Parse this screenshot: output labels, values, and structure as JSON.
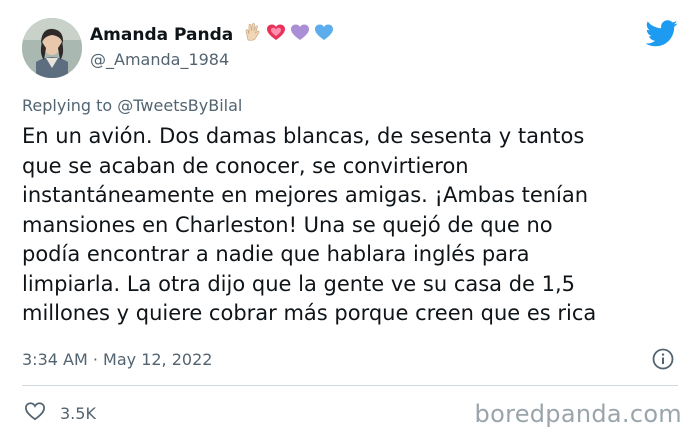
{
  "author": {
    "name": "Amanda Panda",
    "handle": "@_Amanda_1984",
    "emoji_icons": [
      "vulcan-salute-hand",
      "sparkling-heart",
      "purple-heart",
      "blue-heart"
    ]
  },
  "reply": {
    "prefix": "Replying to",
    "mention": "@TweetsByBilal"
  },
  "tweet": {
    "text": "En un avión. Dos damas blancas, de sesenta y tantos\nque se acaban de conocer, se convirtieron\ninstantáneamente en mejores amigas. ¡Ambas tenían\nmansiones en Charleston! Una se quejó de que no\npodía encontrar a nadie que hablara inglés para\nlimpiarla. La otra dijo que la gente ve su casa de 1,5\nmillones y quiere cobrar más porque creen que es rica",
    "timestamp": "3:34 AM · May 12, 2022"
  },
  "engagement": {
    "likes": "3.5K"
  },
  "watermark": "boredpanda.com",
  "colors": {
    "twitter_blue": "#1d9bf0",
    "muted": "#536471",
    "text": "#0f1419"
  }
}
